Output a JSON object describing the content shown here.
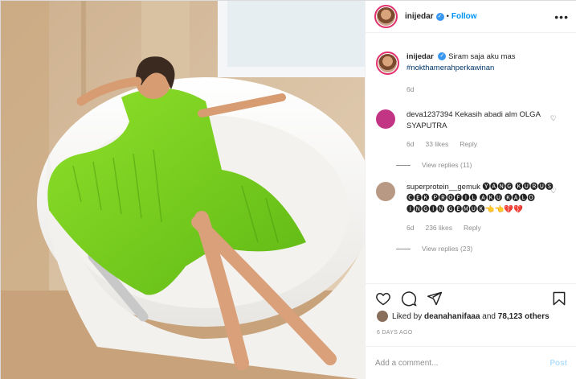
{
  "photo": {
    "alt": ""
  },
  "header": {
    "username": "inijedar",
    "separator": "•",
    "follow_label": "Follow",
    "more_label": "•••"
  },
  "caption": {
    "username": "inijedar",
    "text": "Siram saja aku mas",
    "hashtag": "#nokthamerahperkawinan",
    "age": "6d"
  },
  "comments": [
    {
      "username": "deva1237394",
      "text": "Kekasih abadi alm OLGA SYAPUTRA",
      "age": "6d",
      "likes": "33 likes",
      "reply_label": "Reply",
      "view_replies": "View replies (11)",
      "avatar_color": "#c13584"
    },
    {
      "username": "superprotein__gemuk",
      "text": "🅨🅐🅝🅖 🅚🅤🅡🅤🅢 🅒🅔🅚 🅟🅡🅞🅕🅘🅛 🅐🅚🅤 🅚🅐🅛🅞 🅘🅝🅖🅘🅝 🅖🅔🅜🅤🅚👈👈💔💔",
      "age": "6d",
      "likes": "236 likes",
      "reply_label": "Reply",
      "view_replies": "View replies (23)",
      "avatar_color": "#b89a84"
    }
  ],
  "likes": {
    "prefix": "Liked by",
    "user": "deanahanifaaa",
    "connector": "and",
    "others": "78,123 others"
  },
  "timestamp": "6 DAYS AGO",
  "add_comment": {
    "placeholder": "Add a comment...",
    "post_label": "Post"
  },
  "colors": {
    "accent": "#0095f6",
    "verified": "#3897f0",
    "muted": "#8e8e8e",
    "dress": "#7ed321"
  },
  "icons": [
    "heart-icon",
    "comment-icon",
    "share-icon",
    "bookmark-icon",
    "verified-badge-icon",
    "more-options-icon"
  ]
}
